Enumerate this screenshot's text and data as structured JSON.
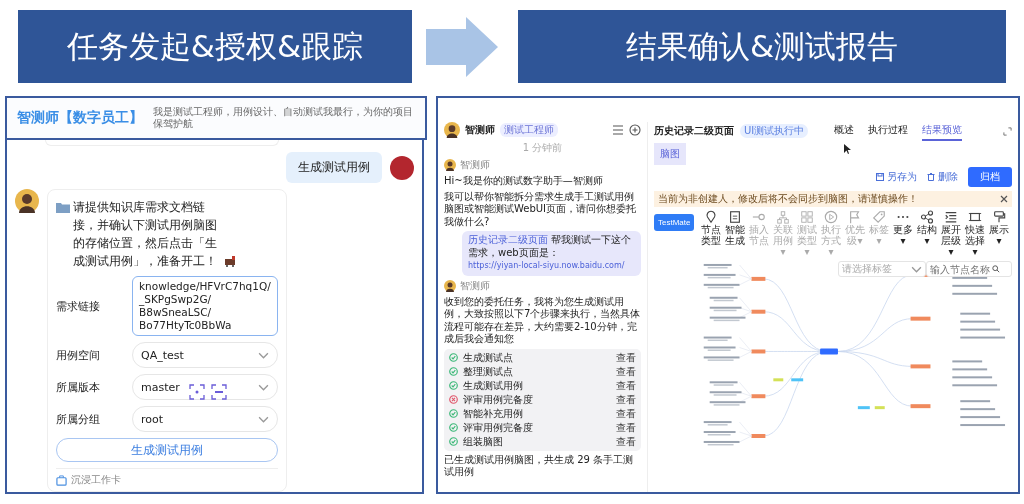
{
  "banners": [
    {
      "title": "任务发起&授权&跟踪"
    },
    {
      "title": "结果确认&测试报告"
    }
  ],
  "left": {
    "header": {
      "title": "智测师【数字员工】",
      "subtitle": "我是测试工程师，用例设计、自动测试我最行，为你的项目保驾护航"
    },
    "user_message": "生成测试用例",
    "bot_message": "请提供知识库需求文档链接，并确认下测试用例脑图的存储位置，然后点击「生成测试用例」，准备开工！",
    "form": [
      {
        "kind": "textarea",
        "label": "需求链接",
        "value": "knowledge/HFVrC7hq1Q/\n_SKPgSwp2G/\nB8wSneaLSC/\nBo77HtyTc0BbWa"
      },
      {
        "kind": "select",
        "label": "用例空间",
        "value": "QA_test"
      },
      {
        "kind": "select",
        "label": "所属版本",
        "value": "master"
      },
      {
        "kind": "select",
        "label": "所属分组",
        "value": "root"
      }
    ],
    "submit": "生成测试用例",
    "footer": "沉浸工作卡"
  },
  "right": {
    "chat": {
      "name": "智测师",
      "role": "测试工程师",
      "time": "1 分钟前",
      "messages": [
        {
          "kind": "bot",
          "sender": "智测师",
          "lines": [
            "Hi~我是你的测试数字助手—智测师",
            "我可以帮你智能拆分需求生成手工测试用例脑图或智能测试WebUI页面，请问你想委托我做什么?"
          ]
        },
        {
          "kind": "user",
          "tag": "历史记录二级页面",
          "text": "帮我测试一下这个需求，web页面是：",
          "link": "https://yiyan-local-siyu.now.baidu.com/"
        },
        {
          "kind": "bot",
          "sender": "智测师",
          "lines": [
            "收到您的委托任务，我将为您生成测试用例，大致按照以下7个步骤来执行，当然具体流程可能存在差异，大约需要2-10分钟，完成后我会通知您"
          ]
        }
      ],
      "steps": [
        {
          "label": "生成测试点",
          "failed": false,
          "action": "查看"
        },
        {
          "label": "整理测试点",
          "failed": false,
          "action": "查看"
        },
        {
          "label": "生成测试用例",
          "failed": false,
          "action": "查看"
        },
        {
          "label": "评审用例完备度",
          "failed": true,
          "action": "查看"
        },
        {
          "label": "智能补充用例",
          "failed": false,
          "action": "查看"
        },
        {
          "label": "评审用例完备度",
          "failed": false,
          "action": "查看"
        },
        {
          "label": "组装脑图",
          "failed": false,
          "action": "查看"
        }
      ],
      "result": "已生成测试用例脑图，共生成 29 条手工测试用例"
    },
    "main": {
      "title": "历史记录二级页面",
      "status": "UI测试执行中",
      "tabs": [
        {
          "label": "概述",
          "selected": false
        },
        {
          "label": "执行过程",
          "selected": false
        },
        {
          "label": "结果预览",
          "selected": true
        }
      ],
      "view_tab": "脑图",
      "actions": [
        {
          "kind": "save_as",
          "label": "另存为"
        },
        {
          "kind": "delete",
          "label": "删除"
        },
        {
          "kind": "primary",
          "label": "归档"
        }
      ],
      "warning": "当前为非创建人，修改后将不会同步到脑图，请谨慎操作！",
      "brand_button": "TestMate",
      "tools": [
        {
          "label": "节点类型",
          "disabled": false
        },
        {
          "label": "智能生成",
          "disabled": false
        },
        {
          "label": "插入节点",
          "disabled": true
        },
        {
          "label": "关联用例▾",
          "disabled": true
        },
        {
          "label": "测试类型▾",
          "disabled": true
        },
        {
          "label": "执行方式▾",
          "disabled": true
        },
        {
          "label": "优先级▾",
          "disabled": true
        },
        {
          "label": "标签▾",
          "disabled": true
        },
        {
          "label": "更多▾",
          "disabled": false
        },
        {
          "label": "结构▾",
          "disabled": false
        },
        {
          "label": "展开层级▾",
          "disabled": false
        },
        {
          "label": "快速选择▾",
          "disabled": false
        },
        {
          "label": "展示▾",
          "disabled": false
        }
      ],
      "tag_select": {
        "placeholder": "请选择标签"
      },
      "node_search": {
        "placeholder": "输入节点名称"
      }
    }
  }
}
